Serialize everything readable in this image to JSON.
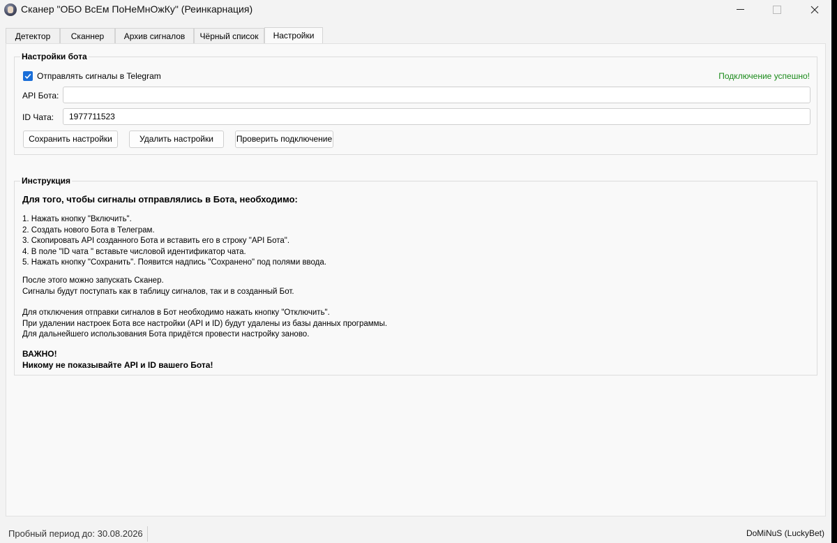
{
  "window": {
    "title": "Сканер \"ОБО ВсЕм ПоНеМнОжКу\" (Реинкарнация)"
  },
  "tabs": [
    {
      "label": "Детектор",
      "active": false
    },
    {
      "label": "Сканнер",
      "active": false
    },
    {
      "label": "Архив сигналов",
      "active": false
    },
    {
      "label": "Чёрный список",
      "active": false
    },
    {
      "label": "Настройки",
      "active": true
    }
  ],
  "bot_settings": {
    "group_title": "Настройки бота",
    "send_signals_label": "Отправлять сигналы в Telegram",
    "send_signals_checked": true,
    "connection_status": "Подключение успешно!",
    "api_label": "API Бота:",
    "api_value": "",
    "chat_label": "ID Чата:",
    "chat_value": "1977711523",
    "save_button": "Сохранить настройки",
    "delete_button": "Удалить настройки",
    "check_button": "Проверить подключение"
  },
  "instructions": {
    "group_title": "Инструкция",
    "heading": "Для того, чтобы сигналы отправлялись в Бота, необходимо:",
    "steps": [
      "1. Нажать кнопку \"Включить\".",
      "2. Создать нового Бота в Телеграм.",
      "3. Скопировать API созданного Бота и вставить его в строку \"API Бота\".",
      "4. В поле \"ID чата \" вставьте числовой идентификатор чата.",
      "5. Нажать кнопку \"Сохранить\". Появится надпись \"Сохранено\" под полями ввода."
    ],
    "after": [
      "После этого можно запускать Сканер.",
      "Сигналы будут поступать как в таблицу сигналов, так и в созданный Бот."
    ],
    "disable": [
      "Для отключения отправки сигналов в Бот необходимо нажать кнопку \"Отключить\".",
      "При удалении настроек Бота все настройки (API и ID) будут удалены из базы данных программы.",
      "Для дальнейшего использования Бота придётся провести настройку заново."
    ],
    "warning_title": "ВАЖНО!",
    "warning_text": "Никому не показывайте API и ID вашего Бота!"
  },
  "statusbar": {
    "trial": "Пробный период до: 30.08.2026",
    "author": "DoMiNuS (LuckyBet)"
  },
  "colors": {
    "accent": "#1a6ed8",
    "success": "#1a8a1a"
  }
}
